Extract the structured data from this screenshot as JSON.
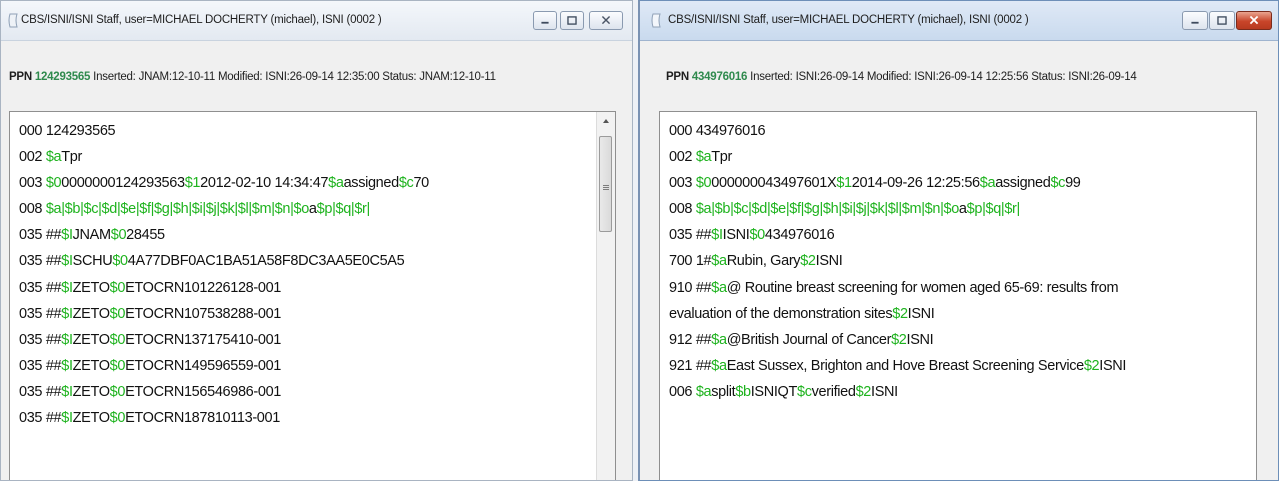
{
  "left": {
    "title": "CBS/ISNI/ISNI Staff, user=MICHAEL DOCHERTY (michael), ISNI (0002 )",
    "info": {
      "ppn_label": "PPN",
      "ppn_value": "124293565",
      "rest": "Inserted: JNAM:12-10-11 Modified: ISNI:26-09-14 12:35:00 Status: JNAM:12-10-11"
    },
    "lines": [
      [
        [
          "000 124293565",
          false
        ]
      ],
      [
        [
          "002 ",
          false
        ],
        [
          "$a",
          true
        ],
        [
          "Tpr",
          false
        ]
      ],
      [
        [
          "003 ",
          false
        ],
        [
          "$0",
          true
        ],
        [
          "0000000124293563",
          false
        ],
        [
          "$1",
          true
        ],
        [
          "2012-02-10 14:34:47",
          false
        ],
        [
          "$a",
          true
        ],
        [
          "assigned",
          false
        ],
        [
          "$c",
          true
        ],
        [
          "70",
          false
        ]
      ],
      [
        [
          "008 ",
          false
        ],
        [
          "$a|$b|$c|$d|$e|$f|$g|$h|$i|$j|$k|$l|$m|$n|$o",
          true
        ],
        [
          "a",
          false
        ],
        [
          "$p|$q|$r|",
          true
        ]
      ],
      [
        [
          "035 ##",
          false
        ],
        [
          "$I",
          true
        ],
        [
          "JNAM",
          false
        ],
        [
          "$0",
          true
        ],
        [
          "28455",
          false
        ]
      ],
      [
        [
          "035 ##",
          false
        ],
        [
          "$I",
          true
        ],
        [
          "SCHU",
          false
        ],
        [
          "$0",
          true
        ],
        [
          "4A77DBF0AC1BA51A58F8DC3AA5E0C5A5",
          false
        ]
      ],
      [
        [
          "035 ##",
          false
        ],
        [
          "$I",
          true
        ],
        [
          "ZETO",
          false
        ],
        [
          "$0",
          true
        ],
        [
          "ETOCRN101226128-001",
          false
        ]
      ],
      [
        [
          "035 ##",
          false
        ],
        [
          "$I",
          true
        ],
        [
          "ZETO",
          false
        ],
        [
          "$0",
          true
        ],
        [
          "ETOCRN107538288-001",
          false
        ]
      ],
      [
        [
          "035 ##",
          false
        ],
        [
          "$I",
          true
        ],
        [
          "ZETO",
          false
        ],
        [
          "$0",
          true
        ],
        [
          "ETOCRN137175410-001",
          false
        ]
      ],
      [
        [
          "035 ##",
          false
        ],
        [
          "$I",
          true
        ],
        [
          "ZETO",
          false
        ],
        [
          "$0",
          true
        ],
        [
          "ETOCRN149596559-001",
          false
        ]
      ],
      [
        [
          "035 ##",
          false
        ],
        [
          "$I",
          true
        ],
        [
          "ZETO",
          false
        ],
        [
          "$0",
          true
        ],
        [
          "ETOCRN156546986-001",
          false
        ]
      ],
      [
        [
          "035 ##",
          false
        ],
        [
          "$I",
          true
        ],
        [
          "ZETO",
          false
        ],
        [
          "$0",
          true
        ],
        [
          "ETOCRN187810113-001",
          false
        ]
      ]
    ]
  },
  "right": {
    "title": "CBS/ISNI/ISNI Staff, user=MICHAEL DOCHERTY (michael), ISNI (0002 )",
    "info": {
      "ppn_label": "PPN",
      "ppn_value": "434976016",
      "rest": "Inserted: ISNI:26-09-14 Modified: ISNI:26-09-14 12:25:56 Status: ISNI:26-09-14"
    },
    "lines": [
      [
        [
          "000 434976016",
          false
        ]
      ],
      [
        [
          "002 ",
          false
        ],
        [
          "$a",
          true
        ],
        [
          "Tpr",
          false
        ]
      ],
      [
        [
          "003 ",
          false
        ],
        [
          "$0",
          true
        ],
        [
          "000000043497601X",
          false
        ],
        [
          "$1",
          true
        ],
        [
          "2014-09-26 12:25:56",
          false
        ],
        [
          "$a",
          true
        ],
        [
          "assigned",
          false
        ],
        [
          "$c",
          true
        ],
        [
          "99",
          false
        ]
      ],
      [
        [
          "008 ",
          false
        ],
        [
          "$a|$b|$c|$d|$e|$f|$g|$h|$i|$j|$k|$l|$m|$n|$o",
          true
        ],
        [
          "a",
          false
        ],
        [
          "$p|$q|$r|",
          true
        ]
      ],
      [
        [
          "035 ##",
          false
        ],
        [
          "$I",
          true
        ],
        [
          "ISNI",
          false
        ],
        [
          "$0",
          true
        ],
        [
          "434976016",
          false
        ]
      ],
      [
        [
          "700 1#",
          false
        ],
        [
          "$a",
          true
        ],
        [
          "Rubin, Gary",
          false
        ],
        [
          "$2",
          true
        ],
        [
          "ISNI",
          false
        ]
      ],
      [
        [
          "910 ##",
          false
        ],
        [
          "$a",
          true
        ],
        [
          "@ Routine breast screening for women aged 65-69: results from",
          false
        ]
      ],
      [
        [
          " evaluation of the demonstration sites",
          false
        ],
        [
          "$2",
          true
        ],
        [
          "ISNI",
          false
        ]
      ],
      [
        [
          "912 ##",
          false
        ],
        [
          "$a",
          true
        ],
        [
          "@British Journal of Cancer",
          false
        ],
        [
          "$2",
          true
        ],
        [
          "ISNI",
          false
        ]
      ],
      [
        [
          "921 ##",
          false
        ],
        [
          "$a",
          true
        ],
        [
          "East Sussex, Brighton and Hove Breast Screening Service",
          false
        ],
        [
          "$2",
          true
        ],
        [
          "ISNI",
          false
        ]
      ],
      [
        [
          "006 ",
          false
        ],
        [
          "$a",
          true
        ],
        [
          "split",
          false
        ],
        [
          "$b",
          true
        ],
        [
          "ISNIQT",
          false
        ],
        [
          "$c",
          true
        ],
        [
          "verified",
          false
        ],
        [
          "$2",
          true
        ],
        [
          "ISNI",
          false
        ]
      ]
    ]
  },
  "colors": {
    "subfield": "#1eb31e",
    "ppn": "#2f8a4d",
    "close_button": "#c8452a"
  },
  "icons": [
    "window-icon",
    "minimize-icon",
    "maximize-icon",
    "close-icon",
    "scroll-up-arrow-icon"
  ]
}
